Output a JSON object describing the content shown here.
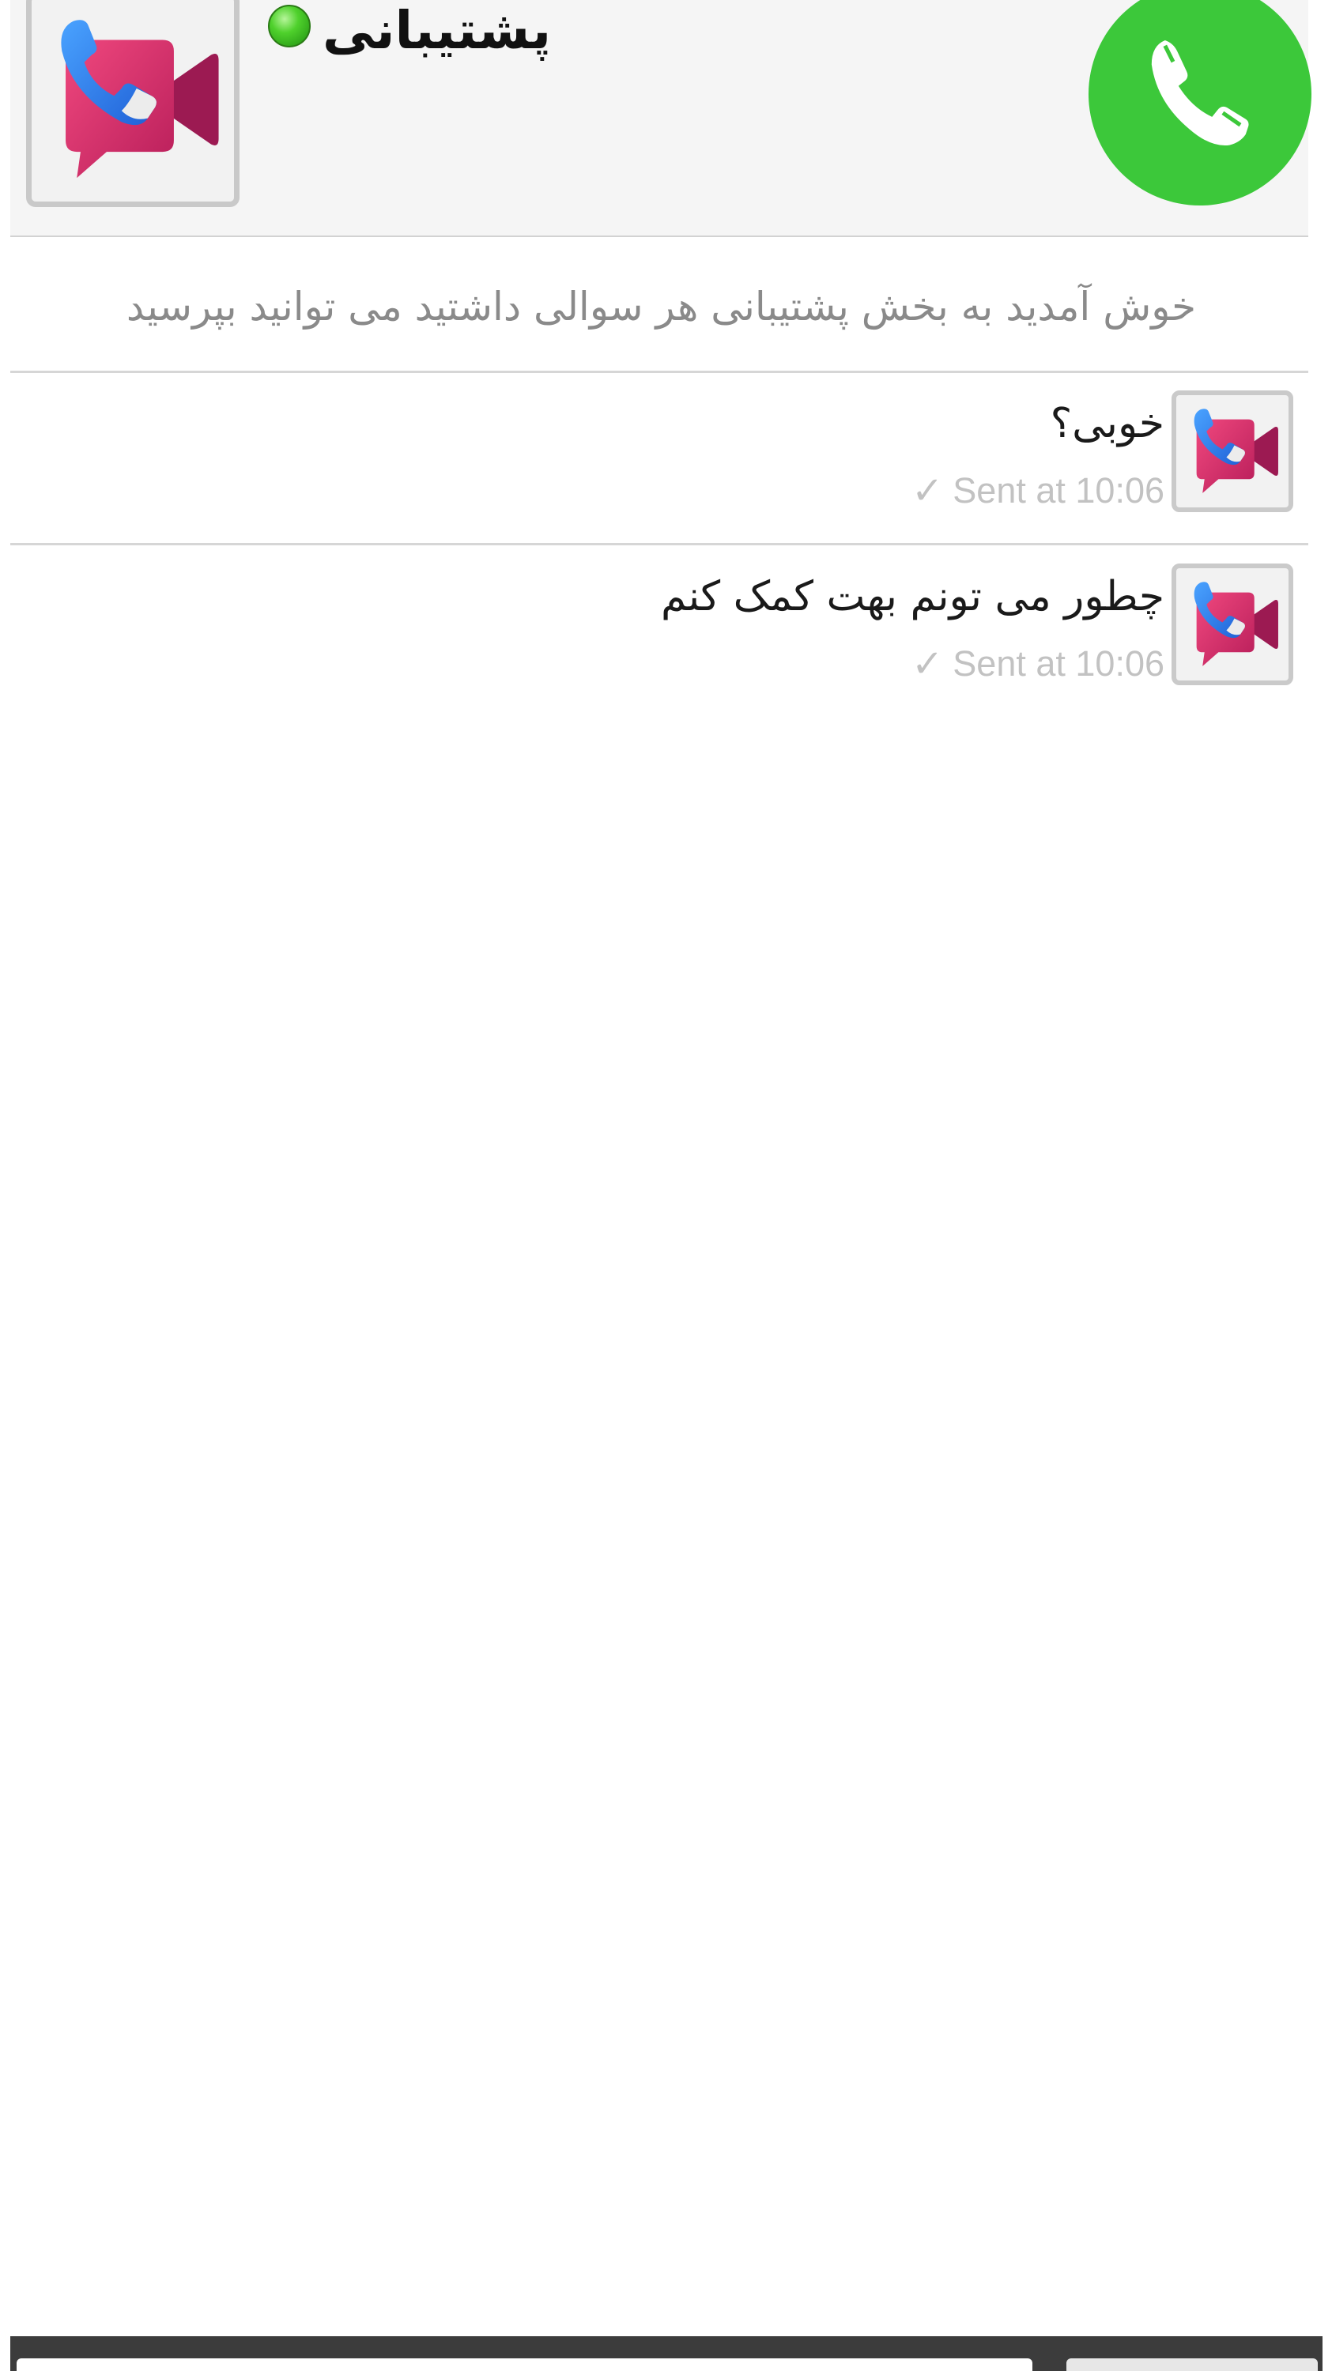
{
  "header": {
    "contact_name": "پشتیبانی",
    "status": "online",
    "avatar_icon": "video-call-app-icon",
    "call_icon": "phone-icon",
    "colors": {
      "call_button": "#3cc83a",
      "status_online": "#4fd12c",
      "header_background": "#f5f5f5"
    }
  },
  "welcome": {
    "text": "خوش آمدید به بخش پشتیبانی هر سوالی داشتید می توانید بپرسید"
  },
  "messages": [
    {
      "text": "خوبی؟",
      "status_icon": "✓",
      "meta": "Sent at 10:06",
      "avatar_icon": "video-call-app-icon"
    },
    {
      "text": "چطور می تونم بهت کمک کنم",
      "status_icon": "✓",
      "meta": "Sent at 10:06",
      "avatar_icon": "video-call-app-icon"
    }
  ],
  "composer": {
    "input_value": "",
    "input_placeholder": "",
    "send_icon": "send-button"
  }
}
